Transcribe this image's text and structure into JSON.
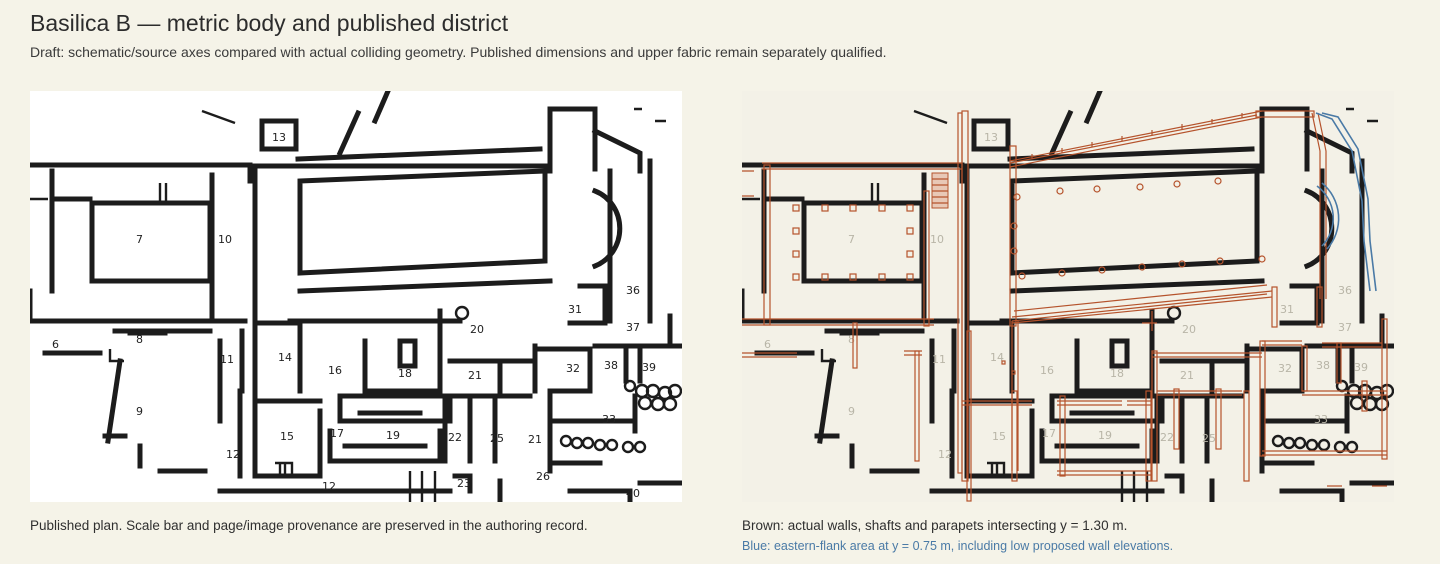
{
  "title": "Basilica B — metric body and published district",
  "subtitle": "Draft: schematic/source axes compared with actual colliding geometry. Published dimensions and upper fabric remain separately qualified.",
  "left_panel": {
    "caption": "Published plan. Scale bar and page/image provenance are preserved in the authoring record.",
    "room_labels": [
      "13",
      "7",
      "10",
      "8",
      "6",
      "9",
      "11",
      "14",
      "16",
      "18",
      "20",
      "21",
      "31",
      "36",
      "37",
      "32",
      "38",
      "39",
      "33",
      "15",
      "17",
      "19",
      "22",
      "25",
      "21",
      "12",
      "12",
      "23",
      "26",
      "40"
    ]
  },
  "right_panel": {
    "caption": "Brown: actual walls, shafts and parapets intersecting y = 1.30 m.",
    "caption_blue": "Blue: eastern-flank area at y = 0.75 m, including low proposed wall elevations."
  },
  "colors": {
    "background": "#f5f3e8",
    "brown": "#b5532c",
    "blue": "#4a7aa6",
    "plan_ink": "#1c1c1c"
  }
}
